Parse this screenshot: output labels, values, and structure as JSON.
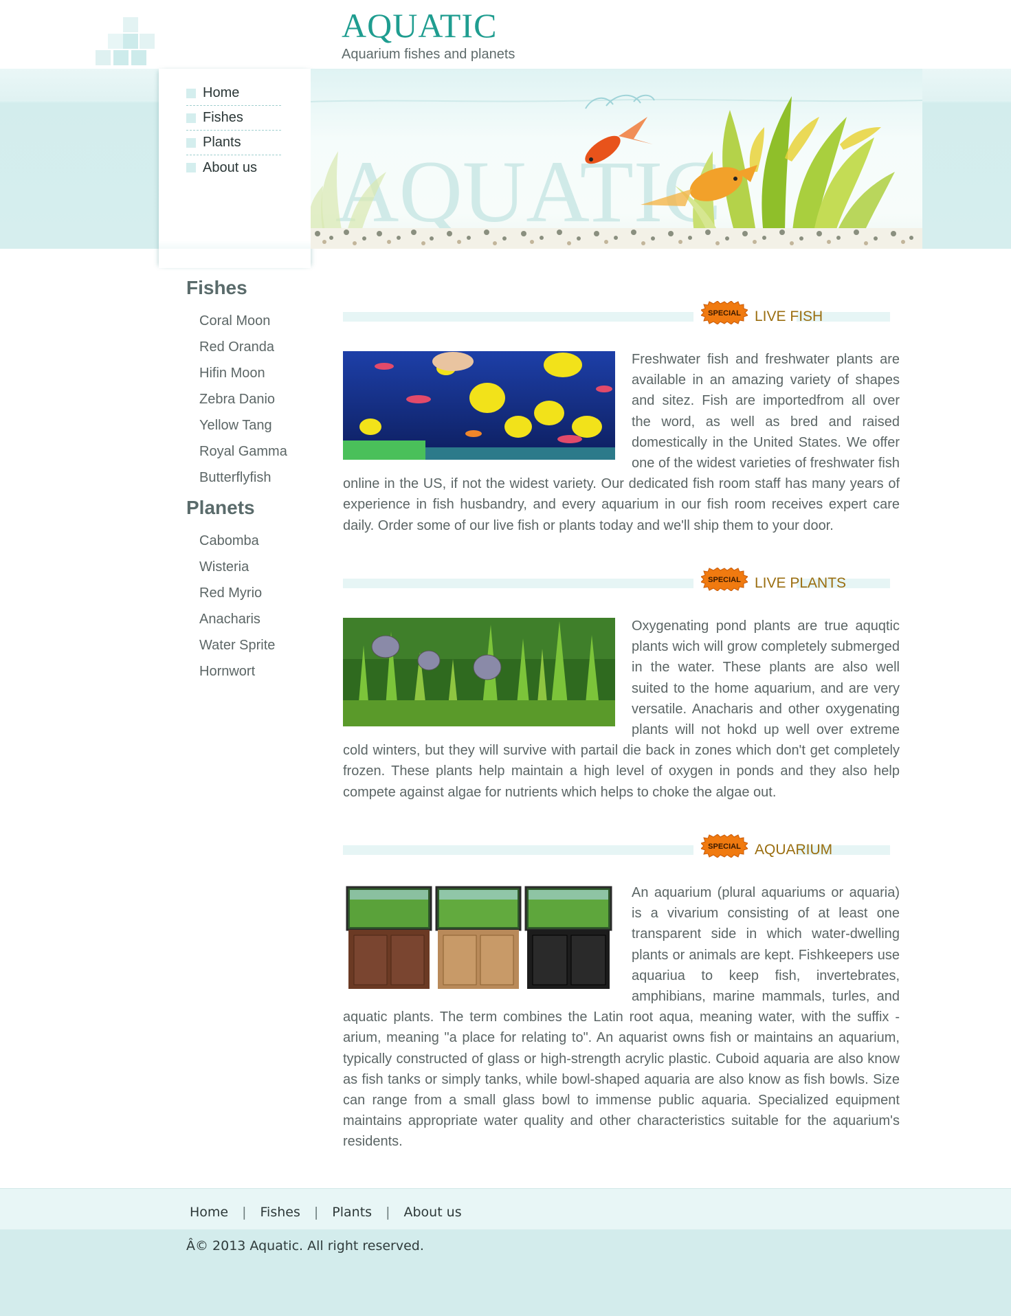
{
  "site": {
    "logo": "AQUATIC",
    "tagline": "Aquarium fishes and planets",
    "banner_watermark": "AQUATIC"
  },
  "nav": {
    "items": [
      {
        "label": "Home"
      },
      {
        "label": "Fishes"
      },
      {
        "label": "Plants"
      },
      {
        "label": "About us"
      }
    ]
  },
  "sidebar": {
    "fishes_heading": "Fishes",
    "fishes": [
      "Coral Moon",
      "Red Oranda",
      "Hifin Moon",
      "Zebra Danio",
      "Yellow Tang",
      "Royal Gamma",
      "Butterflyfish"
    ],
    "planets_heading": "Planets",
    "planets": [
      "Cabomba",
      "Wisteria",
      "Red Myrio",
      "Anacharis",
      "Water Sprite",
      "Hornwort"
    ]
  },
  "sections": [
    {
      "badge": "SPECIAL",
      "title": "LIVE FISH",
      "text": "Freshwater fish and freshwater plants are available in an amazing variety of shapes and sitez. Fish are importedfrom all over the word, as well as bred and raised domestically in the United States. We offer one of the widest varieties of freshwater fish online in the US, if not the widest variety. Our dedicated fish room staff has many years of experience in fish husbandry, and every aquarium in our fish room receives expert care daily. Order some of our live fish or plants today and we'll ship them to your door."
    },
    {
      "badge": "SPECIAL",
      "title": "LIVE PLANTS",
      "text": "Oxygenating pond plants are true aquqtic plants wich will grow completely submerged in the water. These plants are also well suited to the home aquarium, and are very versatile. Anacharis and other oxygenating plants will not hokd up well over extreme cold winters, but they will survive with partail die back in zones which don't get completely frozen. These plants help maintain a high level of oxygen in ponds and they also help compete against algae for nutrients which helps to choke the algae out."
    },
    {
      "badge": "SPECIAL",
      "title": "AQUARIUM",
      "text": "An aquarium (plural aquariums or aquaria) is a vivarium consisting of at least one transparent side in which water-dwelling plants or animals are kept. Fishkeepers use aquariua to keep fish, invertebrates, amphibians, marine mammals, turles, and aquatic plants. The term combines the Latin root aqua, meaning water, with the suffix -arium, meaning \"a place for relating to\". An aquarist owns fish or maintains an aquarium, typically constructed of glass or high-strength acrylic plastic. Cuboid aquaria are also know as fish tanks or simply tanks, while bowl-shaped aquaria are also know as fish bowls. Size can range from a small glass bowl to immense public aquaria. Specialized equipment maintains appropriate water quality and other characteristics suitable for the aquarium's residents."
    }
  ],
  "footer": {
    "links": [
      {
        "label": "Home"
      },
      {
        "label": "Fishes"
      },
      {
        "label": "Plants"
      },
      {
        "label": "About us"
      }
    ],
    "separator": "|",
    "copyright": "Â© 2013 Aquatic. All right reserved."
  },
  "colors": {
    "logo": "#1f9d90",
    "section_title": "#9a6e10",
    "band": "#d6eeee",
    "badge": "#f07a10"
  }
}
